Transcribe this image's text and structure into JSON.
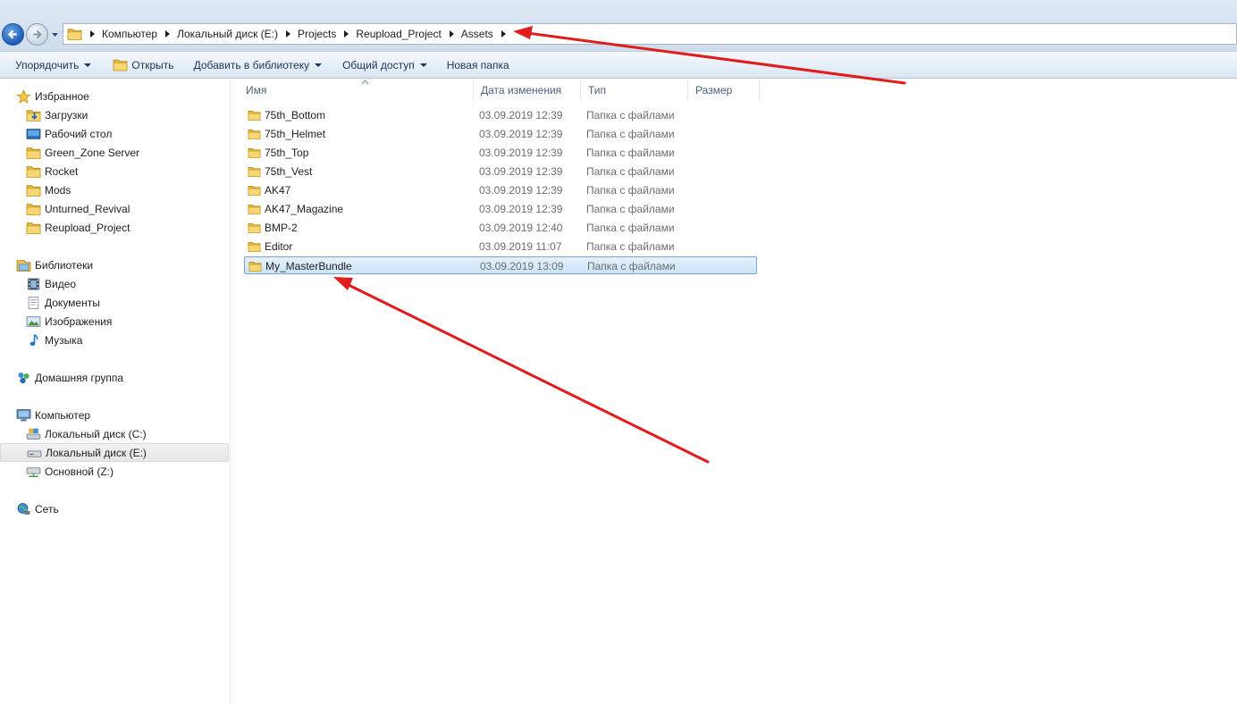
{
  "address": {
    "crumbs": [
      "Компьютер",
      "Локальный диск (E:)",
      "Projects",
      "Reupload_Project",
      "Assets"
    ]
  },
  "toolbar": {
    "organize": "Упорядочить",
    "open": "Открыть",
    "add_library": "Добавить в библиотеку",
    "share": "Общий доступ",
    "new_folder": "Новая папка"
  },
  "sidebar": {
    "favorites": {
      "label": "Избранное",
      "items": [
        "Загрузки",
        "Рабочий стол",
        "Green_Zone Server",
        "Rocket",
        "Mods",
        "Unturned_Revival",
        "Reupload_Project"
      ]
    },
    "libraries": {
      "label": "Библиотеки",
      "items": [
        "Видео",
        "Документы",
        "Изображения",
        "Музыка"
      ]
    },
    "homegroup": {
      "label": "Домашняя группа"
    },
    "computer": {
      "label": "Компьютер",
      "items": [
        "Локальный диск (C:)",
        "Локальный диск (E:)",
        "Основной (Z:)"
      ]
    },
    "network": {
      "label": "Сеть"
    }
  },
  "columns": {
    "name": "Имя",
    "date": "Дата изменения",
    "type": "Тип",
    "size": "Размер"
  },
  "files": [
    {
      "name": "75th_Bottom",
      "date": "03.09.2019 12:39",
      "type": "Папка с файлами"
    },
    {
      "name": "75th_Helmet",
      "date": "03.09.2019 12:39",
      "type": "Папка с файлами"
    },
    {
      "name": "75th_Top",
      "date": "03.09.2019 12:39",
      "type": "Папка с файлами"
    },
    {
      "name": "75th_Vest",
      "date": "03.09.2019 12:39",
      "type": "Папка с файлами"
    },
    {
      "name": "AK47",
      "date": "03.09.2019 12:39",
      "type": "Папка с файлами"
    },
    {
      "name": "AK47_Magazine",
      "date": "03.09.2019 12:39",
      "type": "Папка с файлами"
    },
    {
      "name": "BMP-2",
      "date": "03.09.2019 12:40",
      "type": "Папка с файлами"
    },
    {
      "name": "Editor",
      "date": "03.09.2019 11:07",
      "type": "Папка с файлами"
    },
    {
      "name": "My_MasterBundle",
      "date": "03.09.2019 13:09",
      "type": "Папка с файлами"
    }
  ],
  "colors": {
    "annotation_arrow": "#e01c1c",
    "selection": "#cce4f8",
    "folder": "#f2c94c"
  }
}
